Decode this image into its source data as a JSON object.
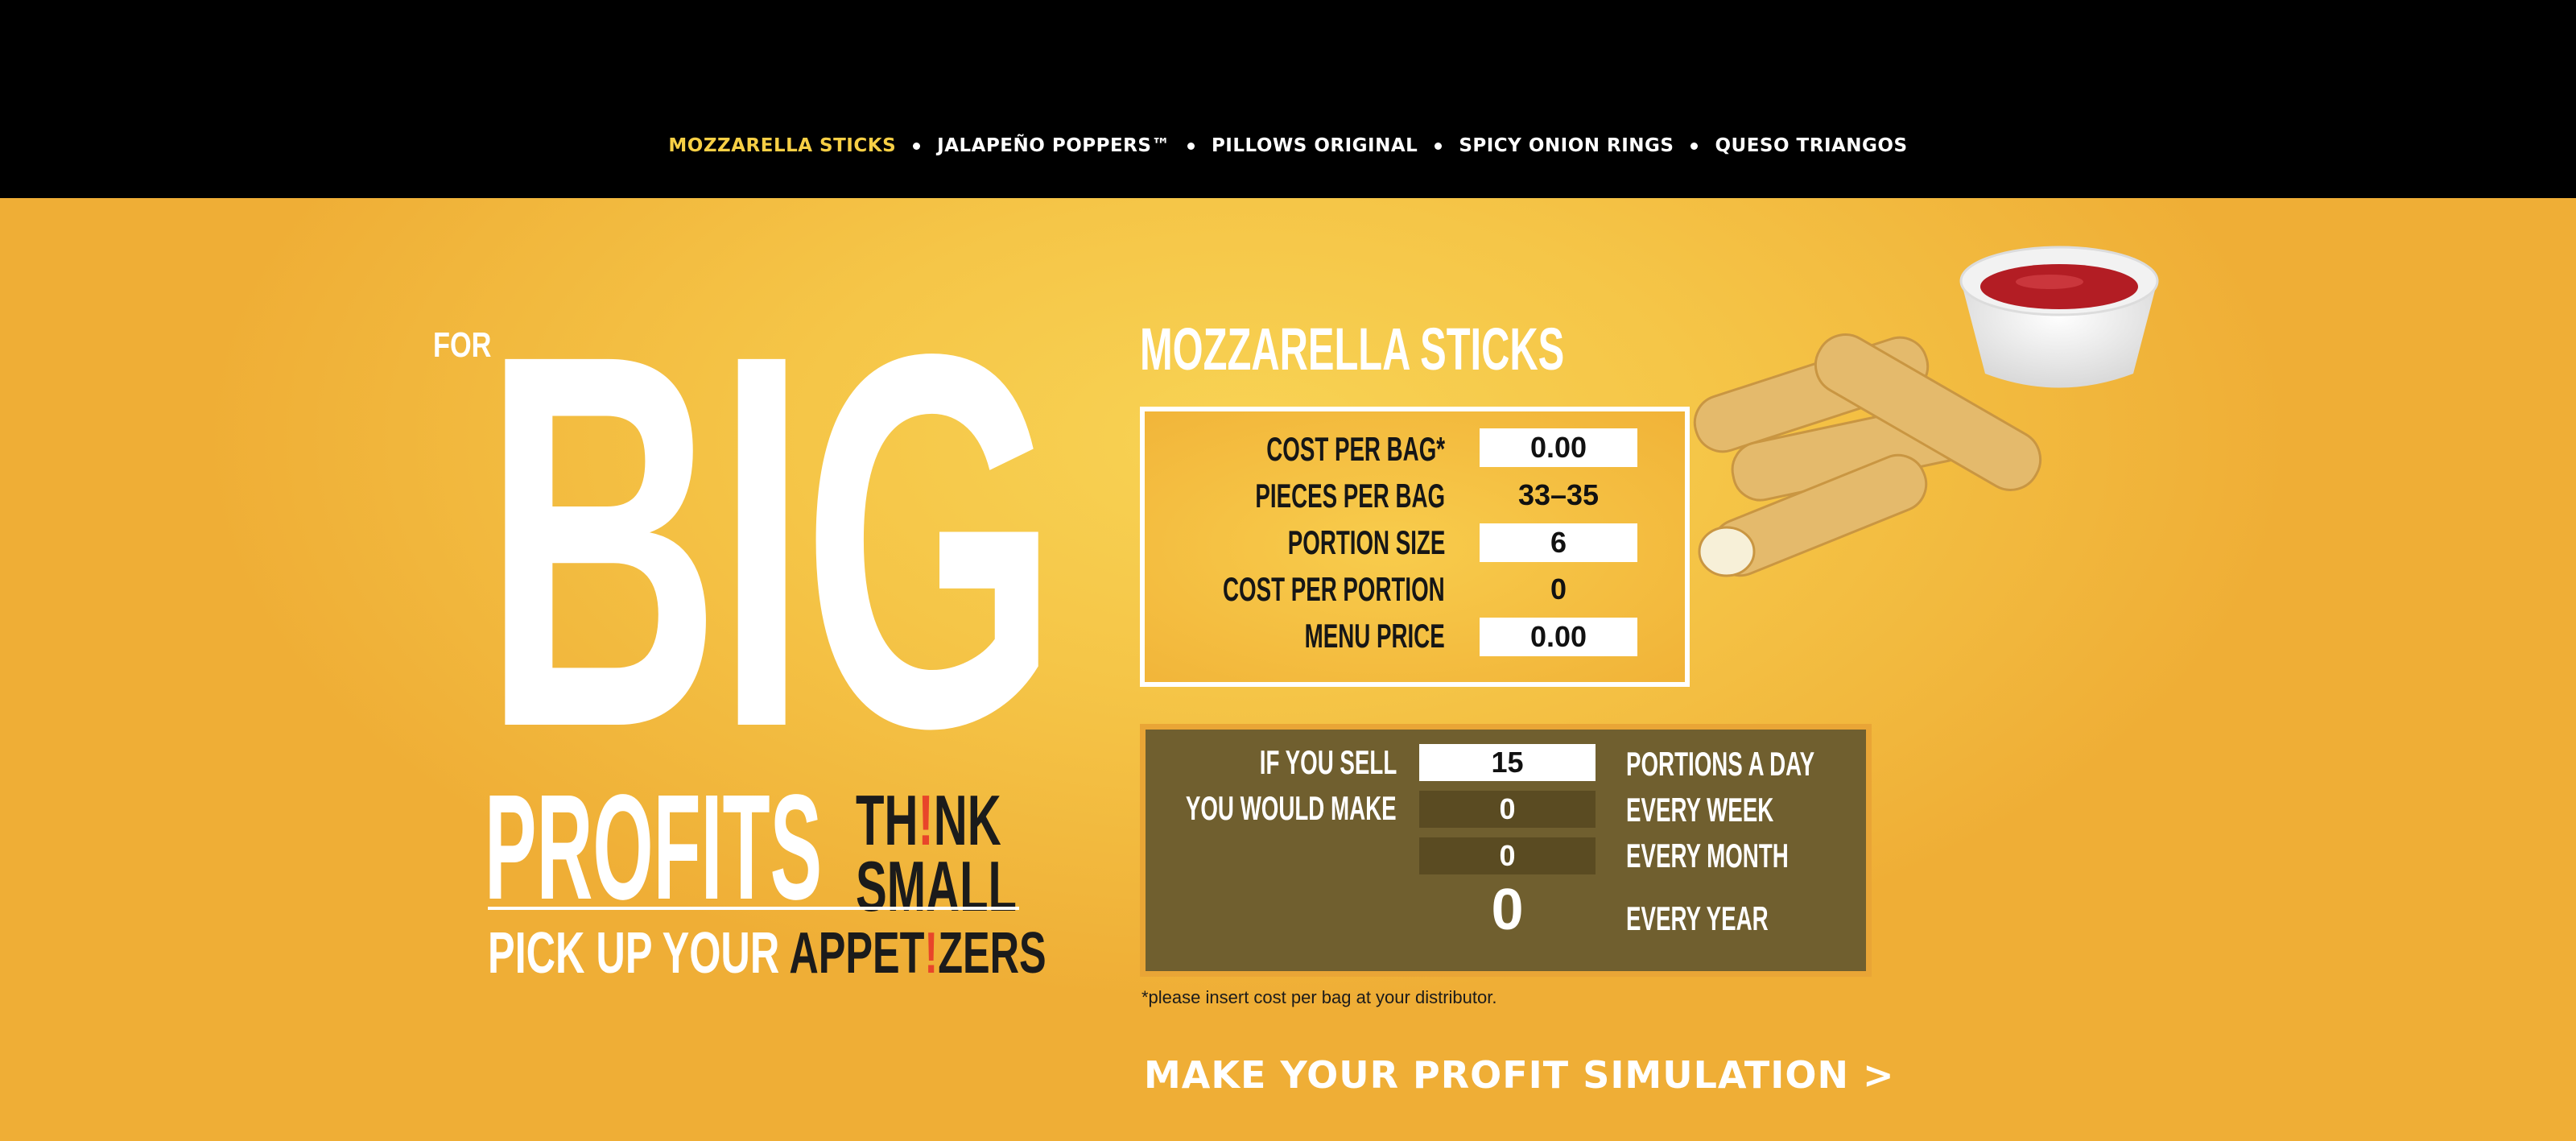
{
  "nav": {
    "items": [
      {
        "label": "MOZZARELLA STICKS",
        "active": true
      },
      {
        "label": "JALAPEÑO POPPERS™",
        "active": false
      },
      {
        "label": "PILLOWS ORIGINAL",
        "active": false
      },
      {
        "label": "SPICY ONION RINGS",
        "active": false
      },
      {
        "label": "QUESO TRIANGOS",
        "active": false
      }
    ]
  },
  "hero": {
    "for": "FOR",
    "big": "BIG",
    "profits": "PROFITS",
    "think_line1_a": "TH",
    "think_line1_bang": "!",
    "think_line1_b": "NK",
    "think_line2": "SMALL",
    "pickup_a": "PICK UP YOUR",
    "pickup_b": "APPET",
    "pickup_bang": "!",
    "pickup_c": "ZERS"
  },
  "product": {
    "title": "MOZZARELLA STICKS",
    "cost_per_bag_label": "COST PER BAG*",
    "cost_per_bag_value": "0.00",
    "pieces_per_bag_label": "PIECES PER BAG",
    "pieces_per_bag_value": "33–35",
    "portion_size_label": "PORTION SIZE",
    "portion_size_value": "6",
    "cost_per_portion_label": "COST PER PORTION",
    "cost_per_portion_value": "0",
    "menu_price_label": "MENU PRICE",
    "menu_price_value": "0.00"
  },
  "profit": {
    "if_you_sell_label": "IF YOU SELL",
    "portions_value": "15",
    "portions_day_label": "PORTIONS A DAY",
    "you_would_make_label": "YOU WOULD MAKE",
    "week_value": "0",
    "week_label": "EVERY WEEK",
    "month_value": "0",
    "month_label": "EVERY MONTH",
    "year_value": "0",
    "year_label": "EVERY YEAR"
  },
  "note": "*please insert cost per bag at your distributor.",
  "cta": "MAKE YOUR PROFIT SIMULATION >",
  "colors": {
    "accent_yellow": "#f7cf45",
    "background": "#f3b93d",
    "panel_brown": "#705f2f",
    "topbar": "#000000"
  }
}
